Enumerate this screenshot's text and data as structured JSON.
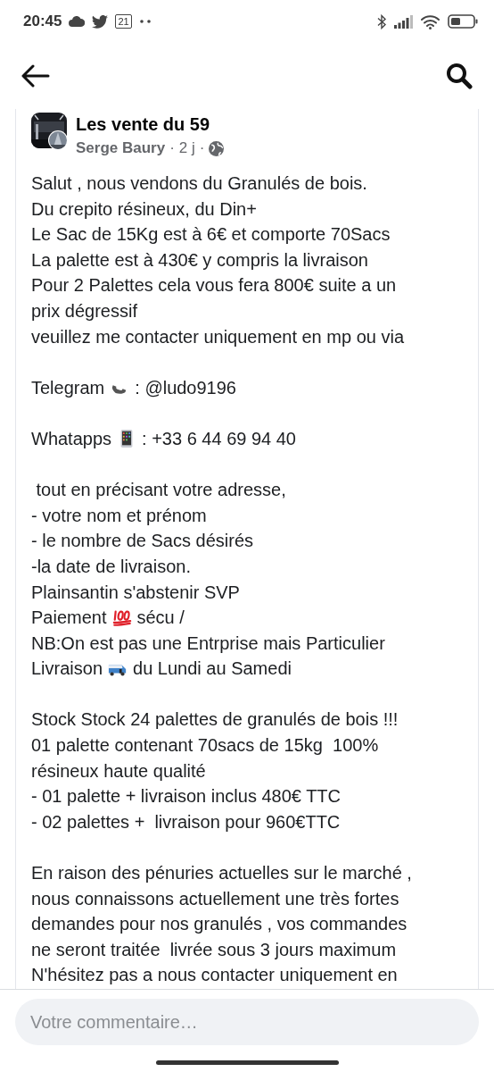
{
  "status_bar": {
    "time": "20:45",
    "calendar_badge": "21"
  },
  "post": {
    "group": "Les vente du 59",
    "author": "Serge Baury",
    "separator_1": "·",
    "age": "2 j",
    "separator_2": "·",
    "paragraphs": [
      {
        "lines": [
          {
            "kind": "text",
            "text": "Salut , nous vendons du Granulés de bois."
          },
          {
            "kind": "text",
            "text": "Du crepito résineux, du Din+"
          },
          {
            "kind": "text",
            "text": "Le Sac de 15Kg est à 6€ et comporte 70Sacs"
          },
          {
            "kind": "text",
            "text": "La palette est à 430€ y compris la livraison"
          },
          {
            "kind": "text",
            "text": "Pour 2 Palettes cela vous fera 800€ suite a un"
          },
          {
            "kind": "text",
            "text": "prix dégressif"
          },
          {
            "kind": "text",
            "text": "veuillez me contacter uniquement en mp ou via"
          }
        ]
      },
      {
        "lines": [
          {
            "kind": "emoji",
            "before": "Telegram",
            "after": ": @ludo9196"
          }
        ]
      },
      {
        "lines": [
          {
            "kind": "emoji",
            "before": "Whatapps",
            "after": ": +33 6 44 69 94 40"
          }
        ]
      },
      {
        "lines": [
          {
            "kind": "text",
            "text": " tout en précisant votre adresse,"
          },
          {
            "kind": "text",
            "text": "- votre nom et prénom"
          },
          {
            "kind": "text",
            "text": "- le nombre de Sacs désirés"
          },
          {
            "kind": "text",
            "text": "-la date de livraison."
          },
          {
            "kind": "text",
            "text": "Plainsantin s'abstenir SVP"
          },
          {
            "kind": "emoji",
            "before": "Paiement",
            "after": "sécu /"
          },
          {
            "kind": "text",
            "text": "NB:On est pas une Entrprise mais Particulier"
          },
          {
            "kind": "emoji",
            "before": "Livraison",
            "after": "du Lundi au Samedi"
          }
        ]
      },
      {
        "lines": [
          {
            "kind": "text",
            "text": "Stock Stock 24 palettes de granulés de bois !!!"
          },
          {
            "kind": "text",
            "text": "01 palette contenant 70sacs de 15kg  100%"
          },
          {
            "kind": "text",
            "text": "résineux haute qualité"
          },
          {
            "kind": "text",
            "text": "- 01 palette + livraison inclus 480€ TTC"
          },
          {
            "kind": "text",
            "text": "- 02 palettes +  livraison pour 960€TTC"
          }
        ]
      },
      {
        "lines": [
          {
            "kind": "text",
            "text": "En raison des pénuries actuelles sur le marché ,"
          },
          {
            "kind": "text",
            "text": "nous connaissons actuellement une très fortes"
          },
          {
            "kind": "text",
            "text": "demandes pour nos granulés , vos commandes"
          },
          {
            "kind": "text",
            "text": "ne seront traitée  livrée sous 3 jours maximum"
          },
          {
            "kind": "text",
            "text": "N'hésitez pas a nous contacter uniquement en"
          }
        ]
      }
    ]
  },
  "comment_field": {
    "placeholder": "Votre commentaire…"
  }
}
